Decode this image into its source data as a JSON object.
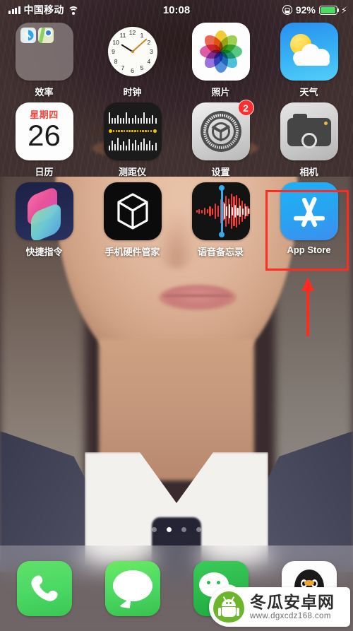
{
  "status_bar": {
    "carrier": "中国移动",
    "signal_icon": "cellular-signal-icon",
    "wifi_icon": "wifi-icon",
    "time": "10:08",
    "lock_icon": "rotation-lock-icon",
    "battery_percent": "92%",
    "battery_icon": "battery-icon",
    "charging_icon": "⚡",
    "battery_color": "#4cd964"
  },
  "home_screen": {
    "rows": [
      [
        {
          "label": "效率",
          "icon": "folder-icon",
          "type": "folder"
        },
        {
          "label": "时钟",
          "icon": "clock-icon",
          "type": "clock"
        },
        {
          "label": "照片",
          "icon": "photos-icon",
          "type": "photos"
        },
        {
          "label": "天气",
          "icon": "weather-icon",
          "type": "weather"
        }
      ],
      [
        {
          "label": "日历",
          "icon": "calendar-icon",
          "type": "calendar",
          "weekday": "星期四",
          "day": "26"
        },
        {
          "label": "测距仪",
          "icon": "measure-icon",
          "type": "measure"
        },
        {
          "label": "设置",
          "icon": "settings-gear-icon",
          "type": "settings",
          "badge": "2"
        },
        {
          "label": "相机",
          "icon": "camera-icon",
          "type": "camera"
        }
      ],
      [
        {
          "label": "快捷指令",
          "icon": "shortcuts-icon",
          "type": "shortcuts"
        },
        {
          "label": "手机硬件管家",
          "icon": "hardware-manager-icon",
          "type": "hardware"
        },
        {
          "label": "语音备忘录",
          "icon": "voice-memos-icon",
          "type": "voice"
        },
        {
          "label": "App Store",
          "icon": "app-store-icon",
          "type": "appstore",
          "highlighted": true
        }
      ]
    ]
  },
  "annotation": {
    "highlight_color": "#ff2b20",
    "arrow_icon": "up-arrow-annotation",
    "highlight_target": "App Store"
  },
  "page_dots": {
    "count": 4,
    "active_index": 1
  },
  "dock": {
    "items": [
      {
        "label": "电话",
        "icon": "phone-icon"
      },
      {
        "label": "信息",
        "icon": "messages-icon"
      },
      {
        "label": "微信",
        "icon": "wechat-icon"
      },
      {
        "label": "QQ",
        "icon": "qq-icon"
      }
    ]
  },
  "watermark": {
    "logo_icon": "android-pear-logo",
    "title": "冬瓜安卓网",
    "url": "www.dgxcdz168.com"
  }
}
